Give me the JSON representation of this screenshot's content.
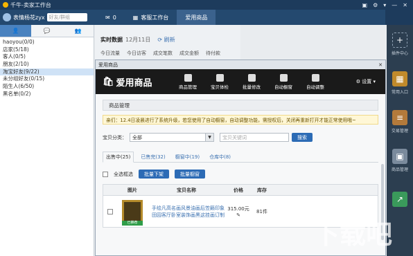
{
  "app": {
    "title": "千牛-卖家工作台",
    "window_buttons": [
      "▣",
      "⚙",
      "▾",
      "—",
      "✕"
    ]
  },
  "user": {
    "name": "表情杨花zyx",
    "search_placeholder": "好友/群组"
  },
  "top_tabs": [
    {
      "label": "0",
      "icon": "mail-icon"
    },
    {
      "label": "客服工作台",
      "icon": "service-icon"
    },
    {
      "label": "爱用商品",
      "icon": ""
    }
  ],
  "side_tabs": [
    "👤",
    "💬",
    "👥"
  ],
  "groups": [
    {
      "label": "haoyou(0/0)"
    },
    {
      "label": "店家(5/18)"
    },
    {
      "label": "客人(0/5)"
    },
    {
      "label": "朋友(2/10)"
    },
    {
      "label": "淘宝好友(9/22)"
    },
    {
      "label": "未分组好友(0/15)"
    },
    {
      "label": "陌生人(6/50)"
    },
    {
      "label": "黑名单(0/2)"
    }
  ],
  "realtime": {
    "title": "实时数据",
    "date": "12月11日",
    "refresh": "刷新",
    "cols": [
      "今日流量",
      "今日访客",
      "成交笔数",
      "成交金额",
      "待付款"
    ]
  },
  "rightbar": [
    {
      "label": "插件中心",
      "icon": "plus-icon"
    },
    {
      "label": "常用入口",
      "icon": "grid-icon"
    },
    {
      "label": "交易管理",
      "icon": "trade-icon"
    },
    {
      "label": "商品管理",
      "icon": "goods-icon"
    },
    {
      "label": "",
      "icon": "chart-icon"
    }
  ],
  "win": {
    "title": "爱用商品",
    "close": "✕",
    "logo": "爱用商品",
    "nav": [
      "商品管理",
      "宝贝体检",
      "批量修改",
      "自动橱窗",
      "自动调整"
    ],
    "settings": "设置",
    "section_title": "商品管理",
    "notice": "亲们：12.4日凌晨进行了系统升级，若您使用了自动橱窗，自动调整功能，需授权后，关闭再重新打开才能正常使用哦~",
    "filter_label": "宝贝分类：",
    "filter_value": "全部",
    "keyword_placeholder": "宝贝关键词",
    "search_btn": "搜索",
    "subtabs": [
      "出售中(25)",
      "已售完(32)",
      "橱窗中(19)",
      "仓库中(8)"
    ],
    "select_all": "全选框选",
    "batch_off": "批量下架",
    "batch_window": "批量橱窗",
    "headers": [
      "图片",
      "宝贝名称",
      "价格",
      "库存"
    ],
    "row": {
      "name": "手绘凡高名画风景油画后笠籁印象田园客厅卧室装饰画黑这挂画订制",
      "price": "315.00元",
      "stock": "81件",
      "tag": "已推荐"
    }
  },
  "watermark": "下载吧"
}
